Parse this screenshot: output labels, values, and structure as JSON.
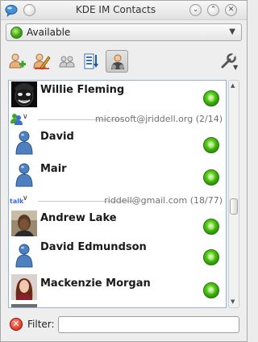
{
  "window": {
    "title": "KDE IM Contacts"
  },
  "status": {
    "selected": "Available",
    "color": "#3fa414"
  },
  "toolbar": {
    "buttons": [
      {
        "name": "add-contact",
        "icon": "add-user-icon"
      },
      {
        "name": "edit-accounts",
        "icon": "edit-pencil-icon"
      },
      {
        "name": "group-contacts",
        "icon": "group-users-icon"
      },
      {
        "name": "sort-contacts",
        "icon": "sort-order-icon"
      },
      {
        "name": "show-offline",
        "icon": "user-filter-icon",
        "active": true
      },
      {
        "name": "settings",
        "icon": "wrench-icon"
      }
    ]
  },
  "contacts": {
    "group_1": {
      "account": "microsoft@jriddell.org (2/14)"
    },
    "group_2": {
      "account": "riddell@gmail.com (18/77)"
    },
    "items": [
      {
        "name": "Willie Fleming",
        "status": "online"
      },
      {
        "name": "David",
        "status": "online"
      },
      {
        "name": "Mair",
        "status": "online"
      },
      {
        "name": "Andrew Lake",
        "status": "online"
      },
      {
        "name": "David Edmundson",
        "status": "online"
      },
      {
        "name": "Mackenzie Morgan",
        "status": "online"
      }
    ]
  },
  "filter": {
    "label": "Filter:",
    "value": ""
  }
}
